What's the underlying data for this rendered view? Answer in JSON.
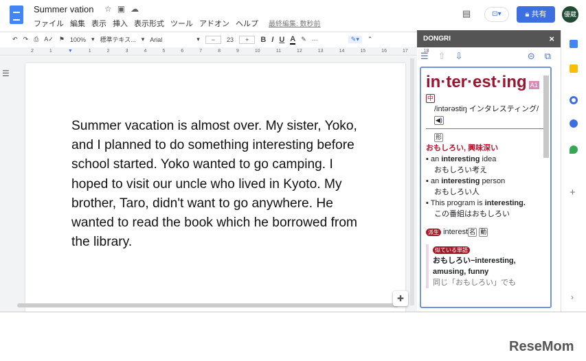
{
  "header": {
    "title": "Summer vation",
    "menu": [
      "ファイル",
      "編集",
      "表示",
      "挿入",
      "表示形式",
      "ツール",
      "アドオン",
      "ヘルプ"
    ],
    "last_edit": "最終編集: 数秒前",
    "share": "共有",
    "avatar": "優蔵"
  },
  "toolbar": {
    "zoom": "100%",
    "style": "標準テキス...",
    "font": "Arial",
    "size": "23",
    "minus": "−",
    "plus": "+",
    "bold": "B",
    "italic": "I",
    "underline": "U",
    "color": "A",
    "more": "···"
  },
  "ruler": [
    "2",
    "1",
    "1",
    "2",
    "3",
    "4",
    "5",
    "6",
    "7",
    "8",
    "9",
    "10",
    "11",
    "12",
    "13",
    "14",
    "15",
    "16",
    "17",
    "18"
  ],
  "document": {
    "text": "Summer vacation is almost over. My sister, Yoko, and I planned to do something interesting before school started.  Yoko wanted to go camping. I hoped to visit our uncle who lived in Kyoto.  My brother, Taro, didn't want to go anywhere.  He wanted to read the book which he borrowed from the library."
  },
  "panel": {
    "title": "DONGRI",
    "close": "×",
    "headword": "in·ter·est·ing",
    "level": "A1",
    "grade": "中",
    "pron": "/intərəstiŋ インタレスティング/",
    "pos": "形",
    "meaning": "おもしろい, 興味深い",
    "examples": [
      {
        "pre": "an ",
        "b": "interesting",
        "post": " idea",
        "ja": "おもしろい考え"
      },
      {
        "pre": "an ",
        "b": "interesting",
        "post": " person",
        "ja": "おもしろい人"
      },
      {
        "pre": "This program is ",
        "b": "interesting.",
        "post": "",
        "ja": "この番組はおもしろい"
      }
    ],
    "derived_label": "派生",
    "derived": "interest",
    "derived_pos1": "名",
    "derived_pos2": "動",
    "similar_label": "似ている単語",
    "similar": "おもしろい−interesting, amusing, funny",
    "cut": "同じ「おもしろい」でも"
  },
  "watermark": "ReseMom"
}
